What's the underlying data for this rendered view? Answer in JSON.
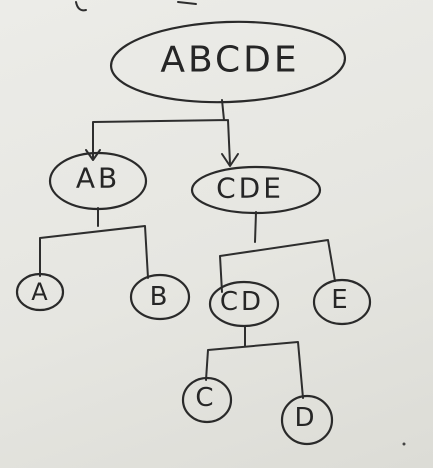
{
  "diagram": {
    "root": {
      "label": "ABCDE"
    },
    "level1": [
      {
        "label": "AB"
      },
      {
        "label": "CDE"
      }
    ],
    "level2": [
      {
        "label": "A"
      },
      {
        "label": "B"
      },
      {
        "label": "CD"
      },
      {
        "label": "E"
      }
    ],
    "level3": [
      {
        "label": "C"
      },
      {
        "label": "D"
      }
    ]
  }
}
